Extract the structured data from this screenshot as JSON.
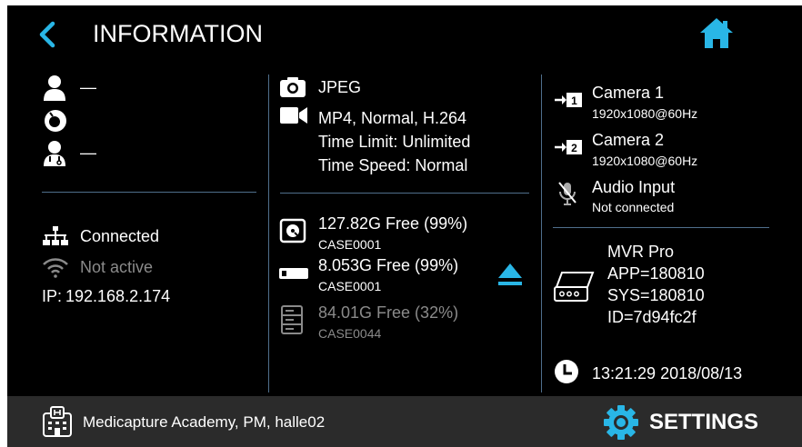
{
  "header": {
    "title": "INFORMATION"
  },
  "patient": {
    "name_value": "—",
    "physician_value": "—"
  },
  "network": {
    "connection_status": "Connected",
    "wifi_status": "Not active",
    "ip_label": "IP:",
    "ip_value": "192.168.2.174"
  },
  "recording": {
    "photo_format": "JPEG",
    "video_format": "MP4, Normal, H.264",
    "time_limit": "Time Limit: Unlimited",
    "time_speed": "Time Speed: Normal"
  },
  "storage": [
    {
      "free": "127.82G Free (99%)",
      "case": "CASE0001"
    },
    {
      "free": "8.053G Free (99%)",
      "case": "CASE0001"
    },
    {
      "free": "84.01G Free (32%)",
      "case": "CASE0044"
    }
  ],
  "inputs": {
    "camera1_name": "Camera 1",
    "camera1_res": "1920x1080@60Hz",
    "camera2_name": "Camera 2",
    "camera2_res": "1920x1080@60Hz",
    "audio_name": "Audio Input",
    "audio_status": "Not connected"
  },
  "device": {
    "model": "MVR Pro",
    "app": "APP=180810",
    "sys": "SYS=180810",
    "id": "ID=7d94fc2f"
  },
  "clock": {
    "datetime": "13:21:29 2018/08/13"
  },
  "footer": {
    "location": "Medicapture Academy, PM, halle02",
    "settings_label": "SETTINGS"
  },
  "colors": {
    "accent": "#29b6e6",
    "background": "#000000",
    "footer_bg": "#2b2b2b",
    "divider": "#4f6f8c",
    "dim_text": "#8a8a8a"
  }
}
